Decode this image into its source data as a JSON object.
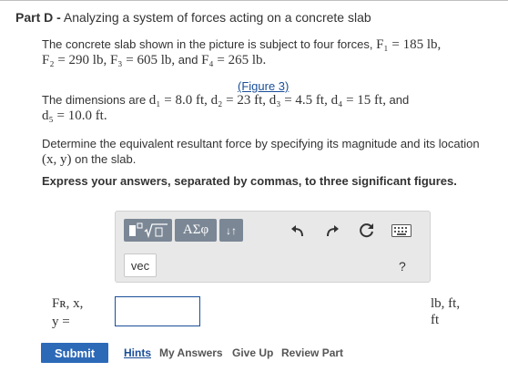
{
  "part": {
    "prefix": "Part D -",
    "title": " Analyzing a system of forces acting on a concrete slab"
  },
  "statement": {
    "line1_text": "The concrete slab shown in the picture is subject to four forces, ",
    "line1_math": "F₁ = 185 lb,",
    "line2_math_a": "F₂ = 290 lb, F₃ = 605 lb,",
    "line2_text": " and ",
    "line2_math_b": "F₄ = 265 lb."
  },
  "figure_link": "(Figure 3)",
  "dimensions": {
    "line1_text": "The dimensions are ",
    "line1_math": "d₁ = 8.0 ft, d₂ = 23 ft, d₃ = 4.5 ft, d₄ = 15 ft,",
    "line1_tail": " and",
    "line2_math": "d₅ = 10.0 ft."
  },
  "determine": {
    "line1": "Determine the equivalent resultant force by specifying its magnitude and its location",
    "line2_math": "(x, y)",
    "line2_text": " on the slab."
  },
  "instruction": "Express your answers, separated by commas, to three significant figures.",
  "toolbar": {
    "templates_icon": "templates-icon",
    "greek_label": "ΑΣφ",
    "sort_label": "↓↑",
    "undo_icon": "undo-icon",
    "redo_icon": "redo-icon",
    "reset_icon": "reset-icon",
    "keyboard_icon": "keyboard-icon",
    "vec_label": "vec",
    "help_label": "?"
  },
  "answer": {
    "label_line1": "Fʀ, x,",
    "label_line2": "y =",
    "value": "",
    "units_line1": "lb, ft,",
    "units_line2": "ft"
  },
  "actions": {
    "submit": "Submit",
    "hints": "Hints",
    "my_answers": "My Answers",
    "give_up": "Give Up",
    "review_part": "Review Part"
  },
  "colors": {
    "accent": "#2c6ab8",
    "link": "#1a4e99",
    "toolbar_button": "#7b8795",
    "editor_bg": "#e8e8e8"
  }
}
